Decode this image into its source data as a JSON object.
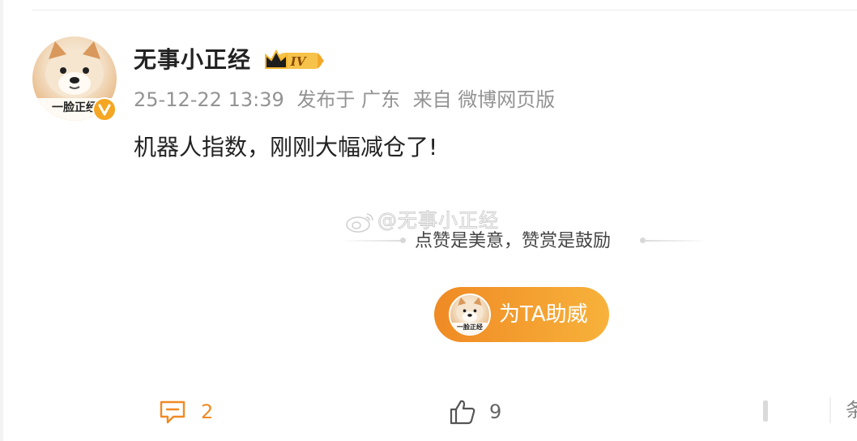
{
  "post": {
    "author": {
      "name": "无事小正经",
      "avatar_caption": "一脸正经",
      "level_badge": "IV"
    },
    "meta": {
      "time": "25-12-22 13:39",
      "location": "发布于 广东",
      "source": "来自 微博网页版"
    },
    "text": "机器人指数，刚刚大幅减仓了!",
    "watermark": "@无事小正经"
  },
  "reward": {
    "tip_text": "点赞是美意，赞赏是鼓励",
    "button_label": "为TA助威",
    "avatar_caption": "一脸正经"
  },
  "actions": {
    "comment_count": "2",
    "like_count": "9",
    "edge_glyph": "条"
  },
  "colors": {
    "accent_orange": "#f08a24",
    "vip_gold": "#f5b731",
    "meta_gray": "#939393"
  },
  "icons": [
    "chevron-crown-icon",
    "verified-v-icon",
    "weibo-logo-icon",
    "comment-icon",
    "thumbs-up-icon"
  ]
}
